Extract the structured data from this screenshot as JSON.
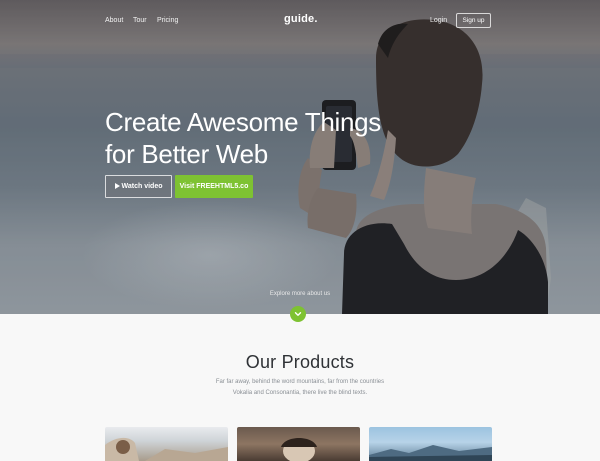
{
  "nav": {
    "about": "About",
    "tour": "Tour",
    "pricing": "Pricing",
    "logo": "guide.",
    "login": "Login",
    "signup": "Sign up"
  },
  "hero": {
    "headline_line1": "Create Awesome Things",
    "headline_line2": "for Better Web",
    "watch_video": "Watch video",
    "visit": "Visit FREEHTML5.co",
    "explore": "Explore more about us"
  },
  "products": {
    "title": "Our Products",
    "subtitle_line1": "Far far away, behind the word mountains, far from the countries",
    "subtitle_line2": "Vokalia and Consonantia, there live the blind texts."
  },
  "colors": {
    "accent": "#7ec232"
  },
  "icons": {
    "play": "play-icon",
    "down": "chevron-down-icon"
  }
}
